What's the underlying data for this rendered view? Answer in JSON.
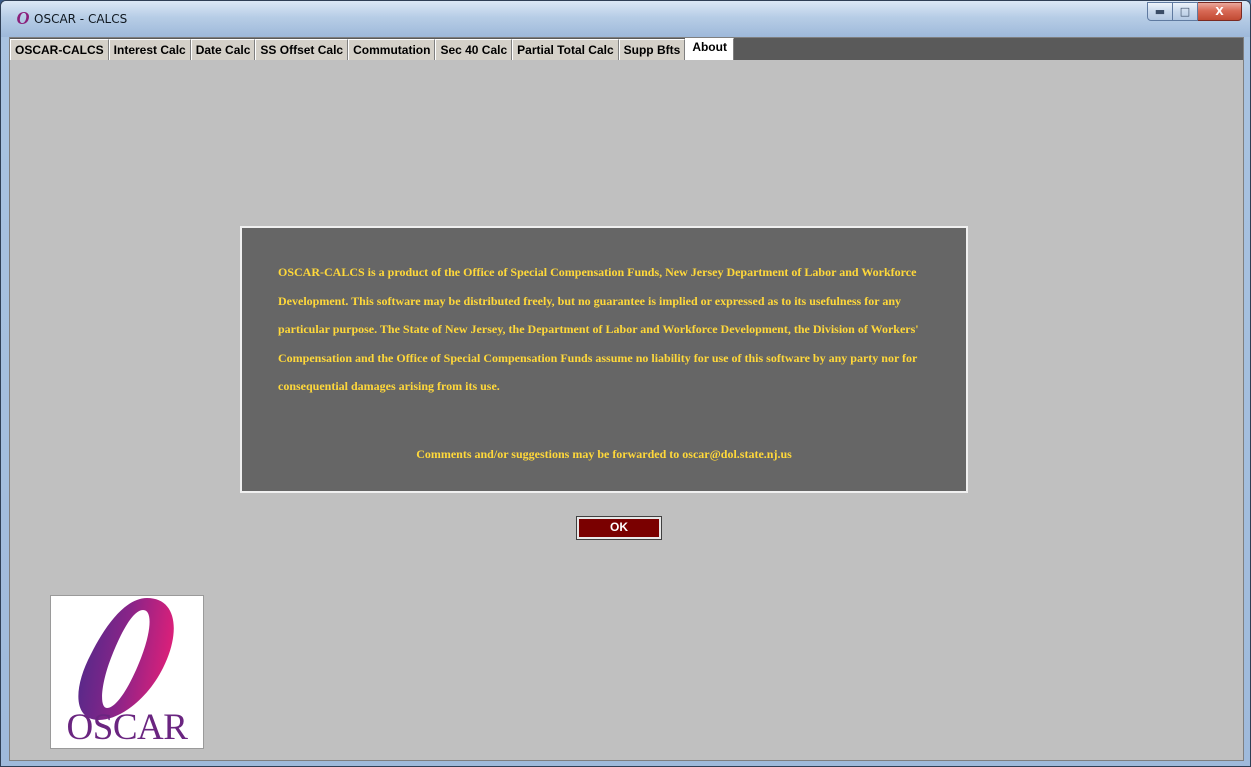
{
  "window": {
    "title": "OSCAR - CALCS",
    "app_icon_glyph": "O",
    "controls": {
      "minimize_icon": "minimize-icon",
      "maximize_icon": "maximize-icon",
      "close_icon": "close-icon",
      "close_label": "X"
    }
  },
  "tabs": [
    {
      "label": "OSCAR-CALCS",
      "active": false
    },
    {
      "label": "Interest Calc",
      "active": false
    },
    {
      "label": "Date Calc",
      "active": false
    },
    {
      "label": "SS Offset Calc",
      "active": false
    },
    {
      "label": "Commutation",
      "active": false
    },
    {
      "label": "Sec 40 Calc",
      "active": false
    },
    {
      "label": "Partial Total Calc",
      "active": false
    },
    {
      "label": "Supp Bfts",
      "active": false
    },
    {
      "label": "About",
      "active": true
    }
  ],
  "about": {
    "disclaimer": "OSCAR-CALCS is a product of the Office of Special Compensation Funds, New Jersey Department of Labor and Workforce Development.  This software may be distributed freely, but no guarantee is implied or expressed as to its usefulness for any particular purpose.  The State of New Jersey, the Department of Labor and Workforce Development, the Division of Workers' Compensation  and the Office of Special Compensation Funds assume no liability for use of this software by any party nor for consequential damages arising from its use.",
    "contact": "Comments and/or suggestions may be forwarded to oscar@dol.state.nj.us",
    "ok_label": "OK"
  },
  "logo": {
    "word": "OSCAR",
    "glyph": "O"
  },
  "colors": {
    "panel_bg": "#c0c0c0",
    "about_bg": "#666666",
    "about_text": "#ffd83a",
    "ok_bg": "#7a0000",
    "logo_purple": "#5b2a86",
    "logo_magenta": "#d0207a"
  }
}
